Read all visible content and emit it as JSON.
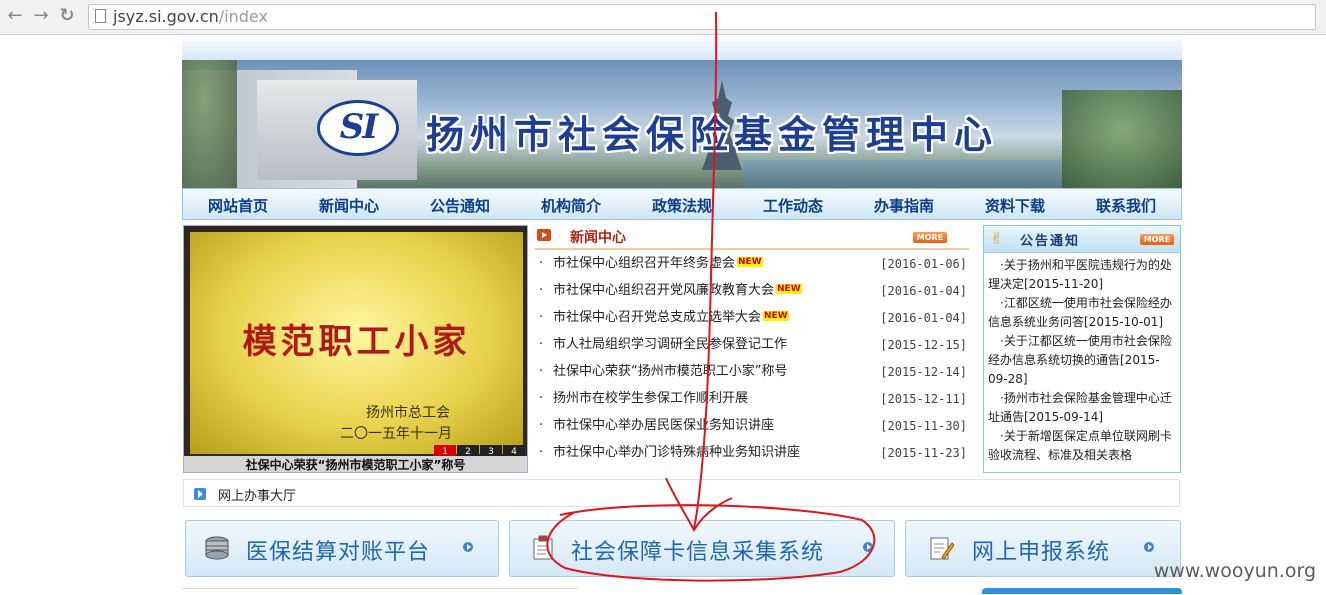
{
  "browser": {
    "url_host": "jsyz.si.gov.cn",
    "url_path": "/index"
  },
  "site": {
    "logo_text": "SI",
    "title": "扬州市社会保险基金管理中心",
    "nav": [
      "网站首页",
      "新闻中心",
      "公告通知",
      "机构简介",
      "政策法规",
      "工作动态",
      "办事指南",
      "资料下载",
      "联系我们"
    ]
  },
  "photo": {
    "plaque_title": "模范职工小家",
    "plaque_org": "扬州市总工会",
    "plaque_date": "二〇一五年十一月",
    "slider_pages": [
      "1",
      "2",
      "3",
      "4"
    ],
    "caption": "社保中心荣获“扬州市模范职工小家”称号"
  },
  "news": {
    "title": "新闻中心",
    "more": "MORE",
    "items": [
      {
        "text": "市社保中心组织召开年终务虚会",
        "new": "NEW",
        "date": "[2016-01-06]"
      },
      {
        "text": "市社保中心组织召开党风廉政教育大会",
        "new": "NEW",
        "date": "[2016-01-04]"
      },
      {
        "text": "市社保中心召开党总支成立选举大会",
        "new": "NEW",
        "date": "[2016-01-04]"
      },
      {
        "text": "市人社局组织学习调研全民参保登记工作",
        "new": "",
        "date": "[2015-12-15]"
      },
      {
        "text": "社保中心荣获“扬州市模范职工小家”称号",
        "new": "",
        "date": "[2015-12-14]"
      },
      {
        "text": "扬州市在校学生参保工作顺利开展",
        "new": "",
        "date": "[2015-12-11]"
      },
      {
        "text": "市社保中心举办居民医保业务知识讲座",
        "new": "",
        "date": "[2015-11-30]"
      },
      {
        "text": "市社保中心举办门诊特殊病种业务知识讲座",
        "new": "",
        "date": "[2015-11-23]"
      }
    ]
  },
  "notice": {
    "title": "公告通知",
    "more": "MORE",
    "items": [
      "·关于扬州和平医院违规行为的处理决定[2015-11-20]",
      "·江都区统一使用市社会保险经办信息系统业务问答[2015-10-01]",
      "·关于江都区统一使用市社会保险经办信息系统切换的通告[2015-09-28]",
      "·扬州市社会保险基金管理中心迁址通告[2015-09-14]",
      "·关于新增医保定点单位联网刷卡验收流程、标准及相关表格"
    ]
  },
  "hall": {
    "title": "网上办事大厅"
  },
  "services": [
    {
      "label": "医保结算对账平台",
      "icon": "database-icon"
    },
    {
      "label": "社会保障卡信息采集系统",
      "icon": "clipboard-icon"
    },
    {
      "label": "网上申报系统",
      "icon": "form-edit-icon"
    }
  ],
  "watermark": "www.wooyun.org",
  "colors": {
    "nav_text": "#0d3e8a",
    "news_title": "#b2260f",
    "service_text": "#1f67b4",
    "annotation": "#e0141e"
  }
}
